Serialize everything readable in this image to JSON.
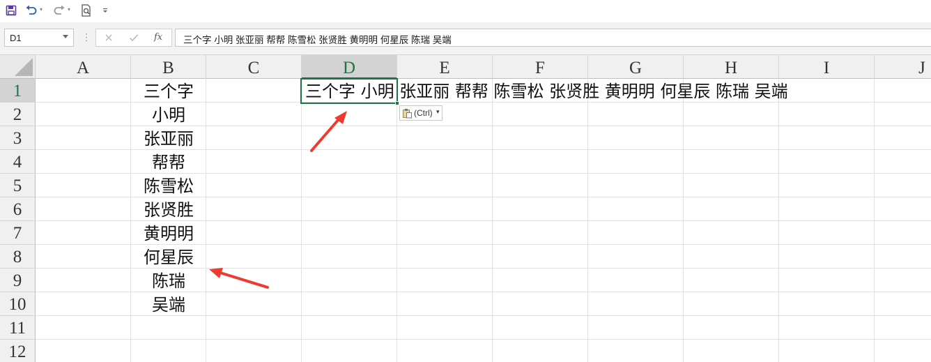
{
  "qat": {
    "icons": [
      "save-icon",
      "undo-icon",
      "redo-icon",
      "print-preview-icon",
      "customize-toolbar-icon"
    ]
  },
  "formula_bar": {
    "name_box": "D1",
    "fx_label": "fx",
    "content": "三个字 小明 张亚丽 帮帮 陈雪松 张贤胜 黄明明 何星辰 陈瑞 吴端"
  },
  "sheet": {
    "columns": [
      "A",
      "B",
      "C",
      "D",
      "E",
      "F",
      "G",
      "H",
      "I",
      "J"
    ],
    "rows": [
      "1",
      "2",
      "3",
      "4",
      "5",
      "6",
      "7",
      "8",
      "9",
      "10",
      "11",
      "12"
    ],
    "selected_cell": "D1",
    "column_b": [
      "三个字",
      "小明",
      "张亚丽",
      "帮帮",
      "陈雪松",
      "张贤胜",
      "黄明明",
      "何星辰",
      "陈瑞",
      "吴端"
    ],
    "row1_text": "三个字  小明  张亚丽  帮帮  陈雪松  张贤胜  黄明明  何星辰  陈瑞  吴端",
    "paste_options_label": "(Ctrl)"
  },
  "colors": {
    "accent": "#217346",
    "arrow": "#ee3b30"
  }
}
